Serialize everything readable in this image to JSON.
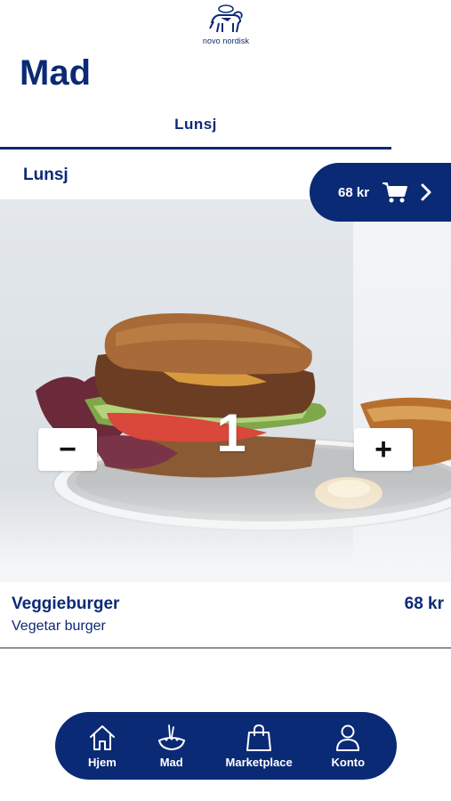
{
  "brand": {
    "logo_text": "novo nordisk"
  },
  "page": {
    "title": "Mad"
  },
  "tabs": [
    {
      "label": "Lunsj",
      "active": true
    }
  ],
  "section": {
    "title": "Lunsj"
  },
  "cart": {
    "price": "68 kr",
    "icon": "cart-icon",
    "chevron": "chevron-right-icon"
  },
  "product": {
    "name": "Veggieburger",
    "description": "Vegetar burger",
    "price": "68 kr",
    "quantity": "1",
    "decrement_label": "−",
    "increment_label": "+"
  },
  "nav": {
    "items": [
      {
        "label": "Hjem",
        "icon": "home-icon"
      },
      {
        "label": "Mad",
        "icon": "food-bowl-icon"
      },
      {
        "label": "Marketplace",
        "icon": "shopping-bag-icon"
      },
      {
        "label": "Konto",
        "icon": "user-icon"
      }
    ]
  },
  "colors": {
    "primary": "#0b2a75",
    "background": "#ffffff",
    "divider": "#8c8f96"
  }
}
